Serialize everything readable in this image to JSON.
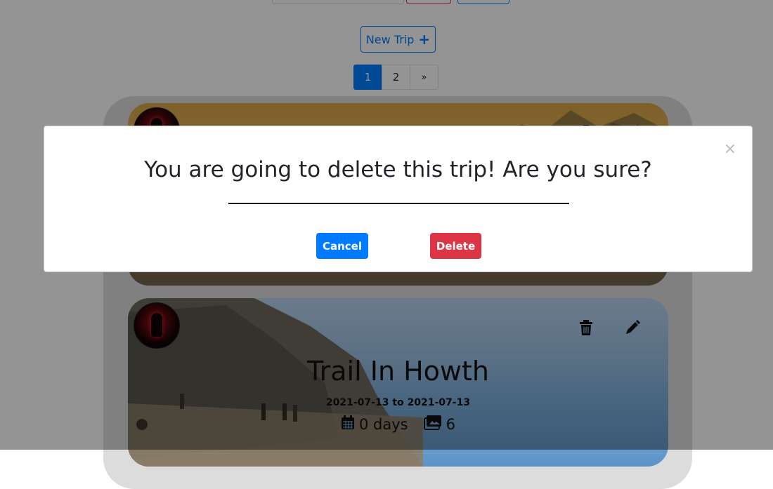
{
  "toolbar": {
    "new_trip_label": "New Trip",
    "new_trip_icon": "plus-icon"
  },
  "pagination": {
    "pages": [
      "1",
      "2"
    ],
    "next_label": "»",
    "active": "1"
  },
  "cards": [
    {
      "title": "",
      "actions": [
        "trash-icon",
        "pencil-icon"
      ]
    },
    {
      "title": "Trail In Howth",
      "dates": "2021-07-13 to 2021-07-13",
      "duration": "0 days",
      "photos": "6",
      "icons": [
        "calendar-icon",
        "images-icon"
      ],
      "actions": [
        "trash-icon",
        "pencil-icon"
      ]
    }
  ],
  "modal": {
    "title": "You are going to delete this trip! Are you sure?",
    "close_label": "×",
    "cancel_label": "Cancel",
    "delete_label": "Delete"
  },
  "colors": {
    "primary": "#007bff",
    "danger": "#dc3545",
    "backdrop": "rgba(0,0,0,0.42)"
  }
}
